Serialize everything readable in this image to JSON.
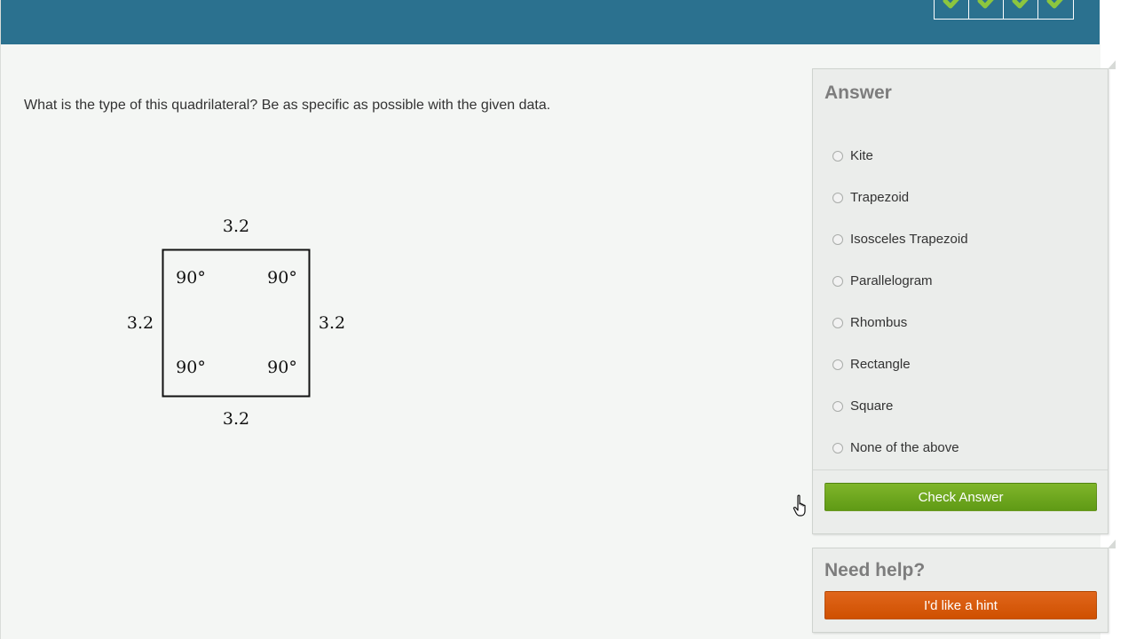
{
  "colors": {
    "header": "#2b718f",
    "page_bg": "#f4f6f4",
    "check_button": "#6ea71f",
    "hint_button": "#d95a0c",
    "streak_check": "#8cc63f"
  },
  "streak": {
    "count": 4,
    "icon": "check-mark-icon"
  },
  "question": {
    "text": "What is the type of this quadrilateral? Be as specific as possible with the given data."
  },
  "figure": {
    "shape": "square",
    "sides": {
      "top": "3.2",
      "left": "3.2",
      "right": "3.2",
      "bottom": "3.2"
    },
    "angles": {
      "top_left": "90°",
      "top_right": "90°",
      "bottom_left": "90°",
      "bottom_right": "90°"
    }
  },
  "answer_panel": {
    "title": "Answer",
    "options": [
      "Kite",
      "Trapezoid",
      "Isosceles Trapezoid",
      "Parallelogram",
      "Rhombus",
      "Rectangle",
      "Square",
      "None of the above"
    ],
    "check_button": "Check Answer"
  },
  "help_panel": {
    "title": "Need help?",
    "hint_button": "I'd like a hint"
  }
}
